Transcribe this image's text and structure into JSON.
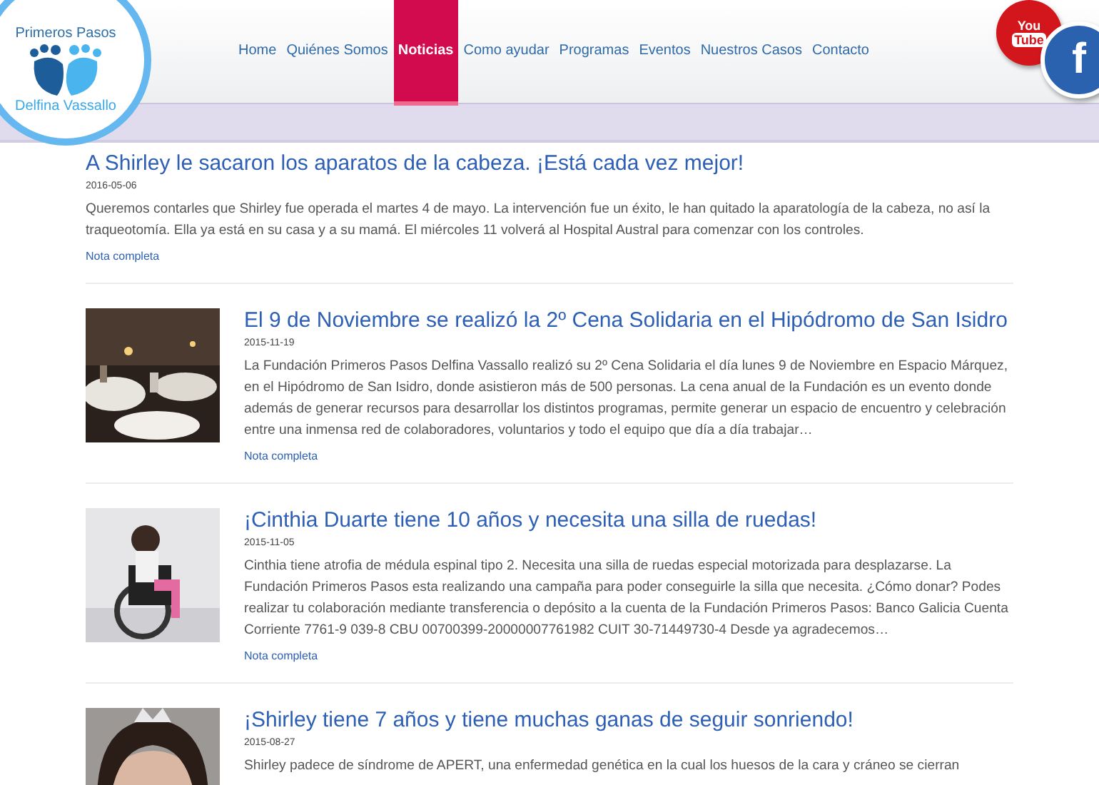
{
  "logo": {
    "top_text": "Primeros Pasos",
    "bottom_text": "Delfina Vassallo"
  },
  "nav": [
    {
      "label": "Home",
      "selected": false
    },
    {
      "label": "Quiénes Somos",
      "selected": false
    },
    {
      "label": "Noticias",
      "selected": true
    },
    {
      "label": "Como ayudar",
      "selected": false
    },
    {
      "label": "Programas",
      "selected": false
    },
    {
      "label": "Eventos",
      "selected": false
    },
    {
      "label": "Nuestros Casos",
      "selected": false
    },
    {
      "label": "Contacto",
      "selected": false
    }
  ],
  "social": [
    {
      "kind": "youtube",
      "label_top": "You",
      "label_bottom": "Tube"
    },
    {
      "kind": "facebook",
      "label_top": "f"
    }
  ],
  "articles": [
    {
      "title": "A Shirley le sacaron los aparatos de la cabeza. ¡Está cada vez mejor!",
      "date": "2016-05-06",
      "body": "Queremos contarles que Shirley fue operada el martes 4 de mayo. La intervención fue un éxito, le han quitado la aparatología de la cabeza, no así la traqueotomía. Ella ya está en su casa y a su mamá. El miércoles 11 volverá al Hospital Austral para comenzar con los controles.",
      "link": "Nota completa"
    },
    {
      "title": "El 9 de Noviembre se realizó la 2º Cena Solidaria en el Hipódromo de San Isidro",
      "date": "2015-11-19",
      "body": "La Fundación Primeros Pasos Delfina Vassallo realizó su 2º Cena Solidaria el día lunes 9 de Noviembre en Espacio Márquez, en el Hipódromo de San Isidro, donde asistieron más de 500 personas. La cena anual de la Fundación es un evento donde además de generar recursos para desarrollar los distintos programas, permite generar un espacio de encuentro y celebración entre una inmensa red de colaboradores, voluntarios y todo el equipo que día a día trabajar…",
      "link": "Nota completa"
    },
    {
      "title": "¡Cinthia Duarte tiene 10 años y necesita una silla de ruedas!",
      "date": "2015-11-05",
      "body": "Cinthia tiene atrofia de médula espinal tipo 2. Necesita una silla de ruedas especial motorizada para desplazarse. La Fundación Primeros Pasos esta realizando una campaña para poder conseguirle la silla que necesita. ¿Cómo donar? Podes realizar tu colaboración mediante transferencia o depósito a la cuenta de la Fundación Primeros Pasos: Banco Galicia Cuenta Corriente 7761-9 039-8 CBU 00700399-20000007761982 CUIT 30-71449730-4 Desde ya agradecemos…",
      "link": "Nota completa"
    },
    {
      "title": "¡Shirley tiene 7 años y tiene muchas ganas de seguir sonriendo!",
      "date": "2015-08-27",
      "body": "Shirley padece de síndrome de APERT, una enfermedad genética en la cual los huesos de la cara y cráneo se cierran"
    }
  ]
}
